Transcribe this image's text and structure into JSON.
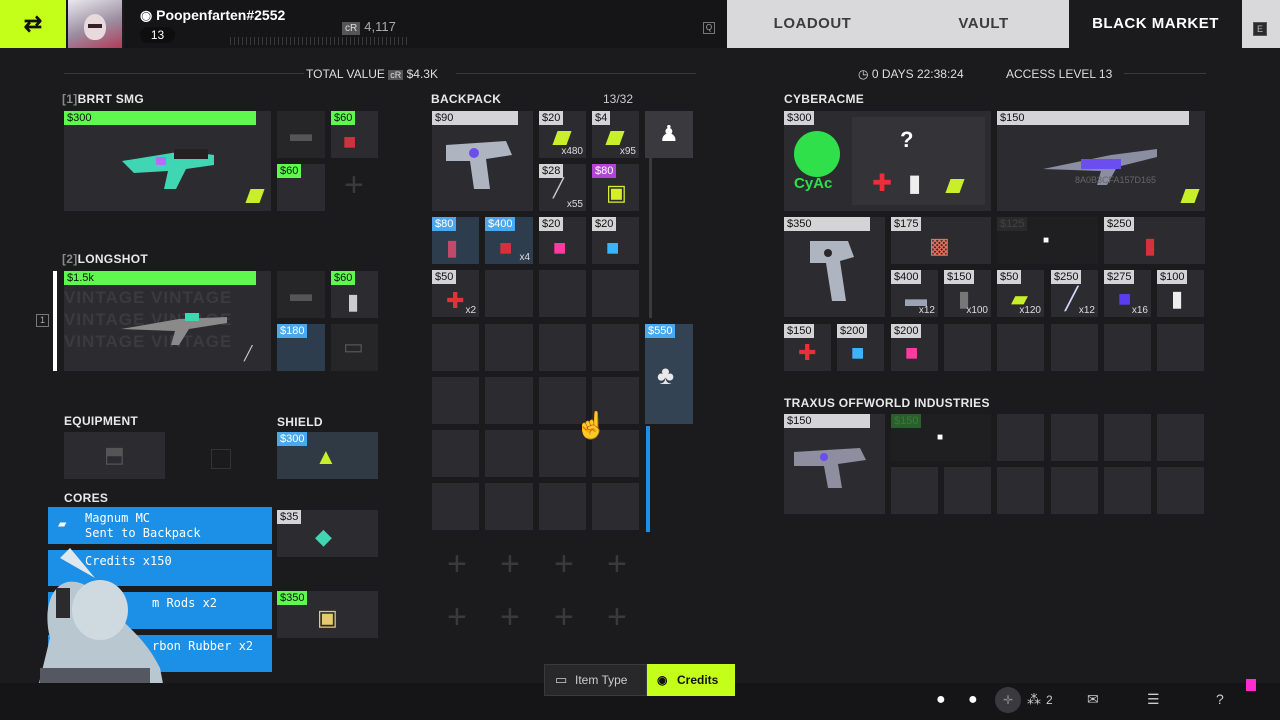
{
  "top": {
    "username": "Poopenfarten#2552",
    "level": "13",
    "credits_prefix": "cR",
    "credits": "4,117",
    "key_left": "Q",
    "key_right": "E",
    "tabs": [
      {
        "label": "LOADOUT"
      },
      {
        "label": "VAULT"
      },
      {
        "label": "BLACK MARKET"
      }
    ]
  },
  "loadout": {
    "total_label": "TOTAL VALUE",
    "total_prefix": "cR",
    "total_value": "$4.3K",
    "slot1": {
      "index": "[1]",
      "name": "BRRT SMG",
      "price": "$300",
      "mod1_price": "$60",
      "mod2_price": "$60"
    },
    "slot2": {
      "index": "[2]",
      "name": "LONGSHOT",
      "price": "$1.5k",
      "watermark": "VINTAGE VINTAGE VINTAGE VINTAGE VINTAGE VINTAGE",
      "mod1_price": "$60",
      "mod2_price": "$180",
      "side_key": "1"
    },
    "equipment_label": "EQUIPMENT",
    "shield_label": "SHIELD",
    "shield_price": "$300",
    "cores_label": "CORES",
    "core1_price": "$35",
    "core2_price": "$350"
  },
  "notifications": [
    {
      "line1": "Magnum MC",
      "line2": "Sent to Backpack"
    },
    {
      "line1": "Credits x150"
    },
    {
      "line1": "m Rods x2"
    },
    {
      "line1": "rbon Rubber x2"
    }
  ],
  "backpack": {
    "title": "BACKPACK",
    "count": "13/32",
    "items": [
      {
        "price": "$90"
      },
      {
        "price": "$20",
        "qty": "x480"
      },
      {
        "price": "$4",
        "qty": "x95"
      },
      {
        "price": "$28",
        "qty": "x55"
      },
      {
        "price": "$80"
      },
      {
        "price": "$80"
      },
      {
        "price": "$400",
        "qty": "x4"
      },
      {
        "price": "$20"
      },
      {
        "price": "$20"
      },
      {
        "price": "$50",
        "qty": "x2"
      }
    ],
    "side_price": "$550"
  },
  "market": {
    "timer": "0 DAYS 22:38:24",
    "access": "ACCESS LEVEL 13",
    "vendor1": {
      "name": "CYBERACME",
      "logo": "CyAc",
      "top_price": "$300",
      "feature_price": "$150",
      "feature_tag": "8A0B3CFA157D165",
      "row2": [
        {
          "price": "$350"
        },
        {
          "price": "$175"
        },
        {
          "price": "$125"
        },
        {
          "price": "$250"
        }
      ],
      "row3": [
        {
          "price": "$400",
          "qty": "x12"
        },
        {
          "price": "$150",
          "qty": "x100"
        },
        {
          "price": "$50",
          "qty": "x120"
        },
        {
          "price": "$250",
          "qty": "x12"
        },
        {
          "price": "$275",
          "qty": "x16"
        },
        {
          "price": "$100"
        }
      ],
      "row4": [
        {
          "price": "$150"
        },
        {
          "price": "$200"
        },
        {
          "price": "$200"
        }
      ]
    },
    "vendor2": {
      "name": "TRAXUS OFFWORLD INDUSTRIES",
      "item_price": "$150",
      "locked_price": "$150"
    }
  },
  "bottom": {
    "item_type": "Item Type",
    "credits": "Credits",
    "squad_count": "2"
  },
  "colors": {
    "accent": "#c4ff1a",
    "blue": "#4aa8ef",
    "green": "#5ef84f",
    "notif": "#1c8fe6"
  }
}
